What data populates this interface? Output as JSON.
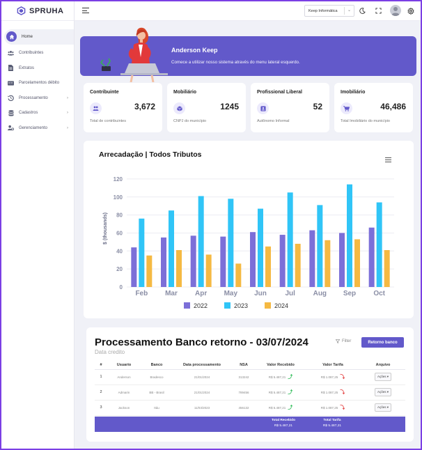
{
  "app": {
    "brand": "SPRUHA"
  },
  "sidebar": {
    "items": [
      {
        "label": "Home",
        "icon": "home-icon",
        "active": true
      },
      {
        "label": "Contribuintes",
        "icon": "users-icon"
      },
      {
        "label": "Extratos",
        "icon": "document-icon"
      },
      {
        "label": "Parcelamentos débito",
        "icon": "card-icon"
      },
      {
        "label": "Processamento",
        "icon": "history-icon",
        "chevron": true
      },
      {
        "label": "Cadastros",
        "icon": "database-icon",
        "chevron": true
      },
      {
        "label": "Gerenciamento",
        "icon": "user-cog-icon",
        "chevron": true
      }
    ]
  },
  "header": {
    "company_select": "Keep Informática",
    "icons": [
      "moon-icon",
      "fullscreen-icon",
      "avatar-icon",
      "gear-icon"
    ]
  },
  "banner": {
    "name": "Anderson Keep",
    "message": "Comece a utilizar nosso sistema através do menu lateral esquerdo."
  },
  "stats": [
    {
      "title": "Contribuinte",
      "value": "3,672",
      "desc": "Total de contribuintes",
      "icon": "users-icon"
    },
    {
      "title": "Mobiliário",
      "value": "1245",
      "desc": "CNPJ do município",
      "icon": "box-icon"
    },
    {
      "title": "Profissional Liberal",
      "value": "52",
      "desc": "Autônomo Informal",
      "icon": "id-card-icon"
    },
    {
      "title": "Imobiliário",
      "value": "46,486",
      "desc": "Total Imobiliário do município",
      "icon": "cart-icon"
    }
  ],
  "chart_data": {
    "type": "bar",
    "title": "Arrecadação | Todos Tributos",
    "ylabel": "$ (thousands)",
    "categories": [
      "Feb",
      "Mar",
      "Apr",
      "May",
      "Jun",
      "Jul",
      "Aug",
      "Sep",
      "Oct"
    ],
    "ylim": [
      0,
      130
    ],
    "yticks": [
      0,
      20,
      40,
      60,
      80,
      100,
      120
    ],
    "legend_position": "bottom",
    "series": [
      {
        "name": "2022",
        "color": "#7c6fd8",
        "values": [
          44,
          55,
          57,
          56,
          61,
          58,
          63,
          60,
          66
        ]
      },
      {
        "name": "2023",
        "color": "#30c5f7",
        "values": [
          76,
          85,
          101,
          98,
          87,
          105,
          91,
          114,
          94
        ]
      },
      {
        "name": "2024",
        "color": "#f5b942",
        "values": [
          35,
          41,
          36,
          26,
          45,
          48,
          52,
          53,
          41
        ]
      }
    ]
  },
  "table": {
    "title": "Processamento Banco retorno - 03/07/2024",
    "subtitle": "Data credito",
    "filter_label": "Filter",
    "button_label": "Retorno banco",
    "columns": [
      "#",
      "Usuario",
      "Banco",
      "Data processamento",
      "NSA",
      "Valor Recebido",
      "Valor Tarifa",
      "Arquivo"
    ],
    "rows": [
      {
        "num": "1",
        "usuario": "Anderson",
        "banco": "Bradesco",
        "data": "21/01/2024",
        "nsa": "313242",
        "recebido": "R$ 5.487,21",
        "tarifa": "R$ 1.087,25",
        "acao": "Ações"
      },
      {
        "num": "2",
        "usuario": "Admarin",
        "banco": "BB - Brasil",
        "data": "21/01/2024",
        "nsa": "789456",
        "recebido": "R$ 5.487,21",
        "tarifa": "R$ 1.087,25",
        "acao": "Ações"
      },
      {
        "num": "3",
        "usuario": "Jackson",
        "banco": "Itáu",
        "data": "11/03/2023",
        "nsa": "456132",
        "recebido": "R$ 5.487,21",
        "tarifa": "R$ 1.087,25",
        "acao": "Ações"
      }
    ],
    "footer": {
      "recebido_label": "Total Recebido",
      "recebido_value": "R$ 5.487,21",
      "tarifa_label": "Total Tarifa",
      "tarifa_value": "R$ 5.487,21"
    }
  }
}
